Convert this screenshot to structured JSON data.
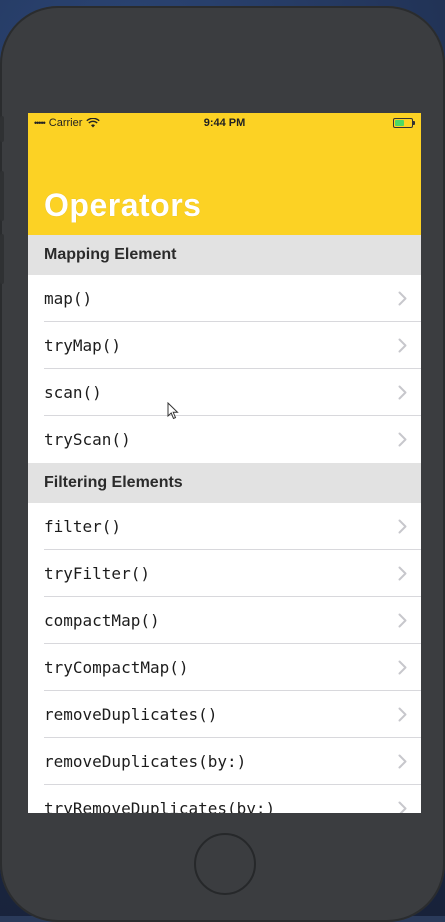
{
  "status_bar": {
    "carrier": "Carrier",
    "time": "9:44 PM"
  },
  "nav": {
    "title": "Operators"
  },
  "sections": [
    {
      "header": "Mapping Element",
      "rows": [
        "map()",
        "tryMap()",
        "scan()",
        "tryScan()"
      ]
    },
    {
      "header": "Filtering Elements",
      "rows": [
        "filter()",
        "tryFilter()",
        "compactMap()",
        "tryCompactMap()",
        "removeDuplicates()",
        "removeDuplicates(by:)",
        "tryRemoveDuplicates(by:)"
      ]
    }
  ],
  "colors": {
    "navbar": "#fcd224",
    "section_header": "#e2e2e2",
    "chevron": "#c7c7cc",
    "battery": "#4cd964"
  },
  "icons": {
    "row_accessory": "chevron-right-icon",
    "wifi": "wifi-icon",
    "battery": "battery-icon"
  }
}
